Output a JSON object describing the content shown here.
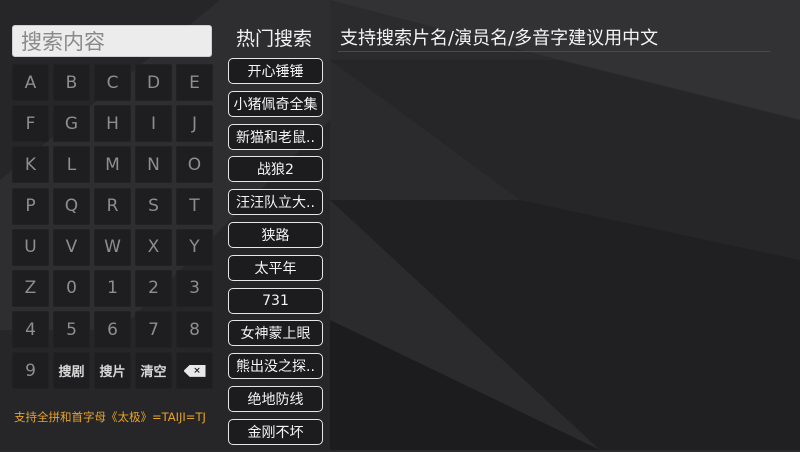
{
  "search": {
    "placeholder": "搜索内容"
  },
  "keyboard": {
    "rows": [
      [
        "A",
        "B",
        "C",
        "D",
        "E"
      ],
      [
        "F",
        "G",
        "H",
        "I",
        "J"
      ],
      [
        "K",
        "L",
        "M",
        "N",
        "O"
      ],
      [
        "P",
        "Q",
        "R",
        "S",
        "T"
      ],
      [
        "U",
        "V",
        "W",
        "X",
        "Y"
      ],
      [
        "Z",
        "0",
        "1",
        "2",
        "3"
      ],
      [
        "4",
        "5",
        "6",
        "7",
        "8"
      ]
    ],
    "last_row": {
      "key_9": "9",
      "search_drama": "搜剧",
      "search_movie": "搜片",
      "clear": "清空",
      "delete_icon": "backspace-icon",
      "delete_glyph": "×"
    }
  },
  "hint": "支持全拼和首字母《太极》=TAIJI=TJ",
  "hot": {
    "title": "热门搜索",
    "items": [
      "开心锤锤",
      "小猪佩奇全集",
      "新猫和老鼠..",
      "战狼2",
      "汪汪队立大..",
      "狭路",
      "太平年",
      "731",
      "女神蒙上眼",
      "熊出没之探..",
      "绝地防线",
      "金刚不坏"
    ]
  },
  "results": {
    "title": "支持搜索片名/演员名/多音字建议用中文"
  },
  "colors": {
    "background": "#2a2a2c",
    "hint": "#e8a228",
    "key_bg": "#1e1e20"
  }
}
